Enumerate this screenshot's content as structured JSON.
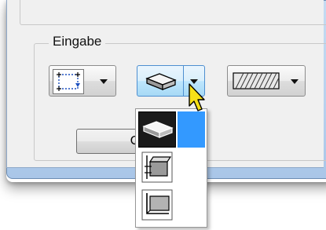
{
  "group": {
    "label": "Eingabe"
  },
  "ok_button": {
    "label": "O"
  },
  "colors": {
    "frame_blue": "#b7d1ee",
    "selection_blue": "#3399ff",
    "client_gray": "#f0f0f0"
  },
  "icons": {
    "input_mode": "dotted-rectangle-icon",
    "surface": "slab-icon",
    "hatch": "hatch-pattern-icon",
    "cursor": "arrow-cursor-icon"
  },
  "dropdown": {
    "open": true,
    "items": [
      {
        "icon": "slab-icon",
        "selected": true
      },
      {
        "icon": "wall-section-icon",
        "selected": false
      },
      {
        "icon": "corner-section-icon",
        "selected": false
      }
    ]
  }
}
